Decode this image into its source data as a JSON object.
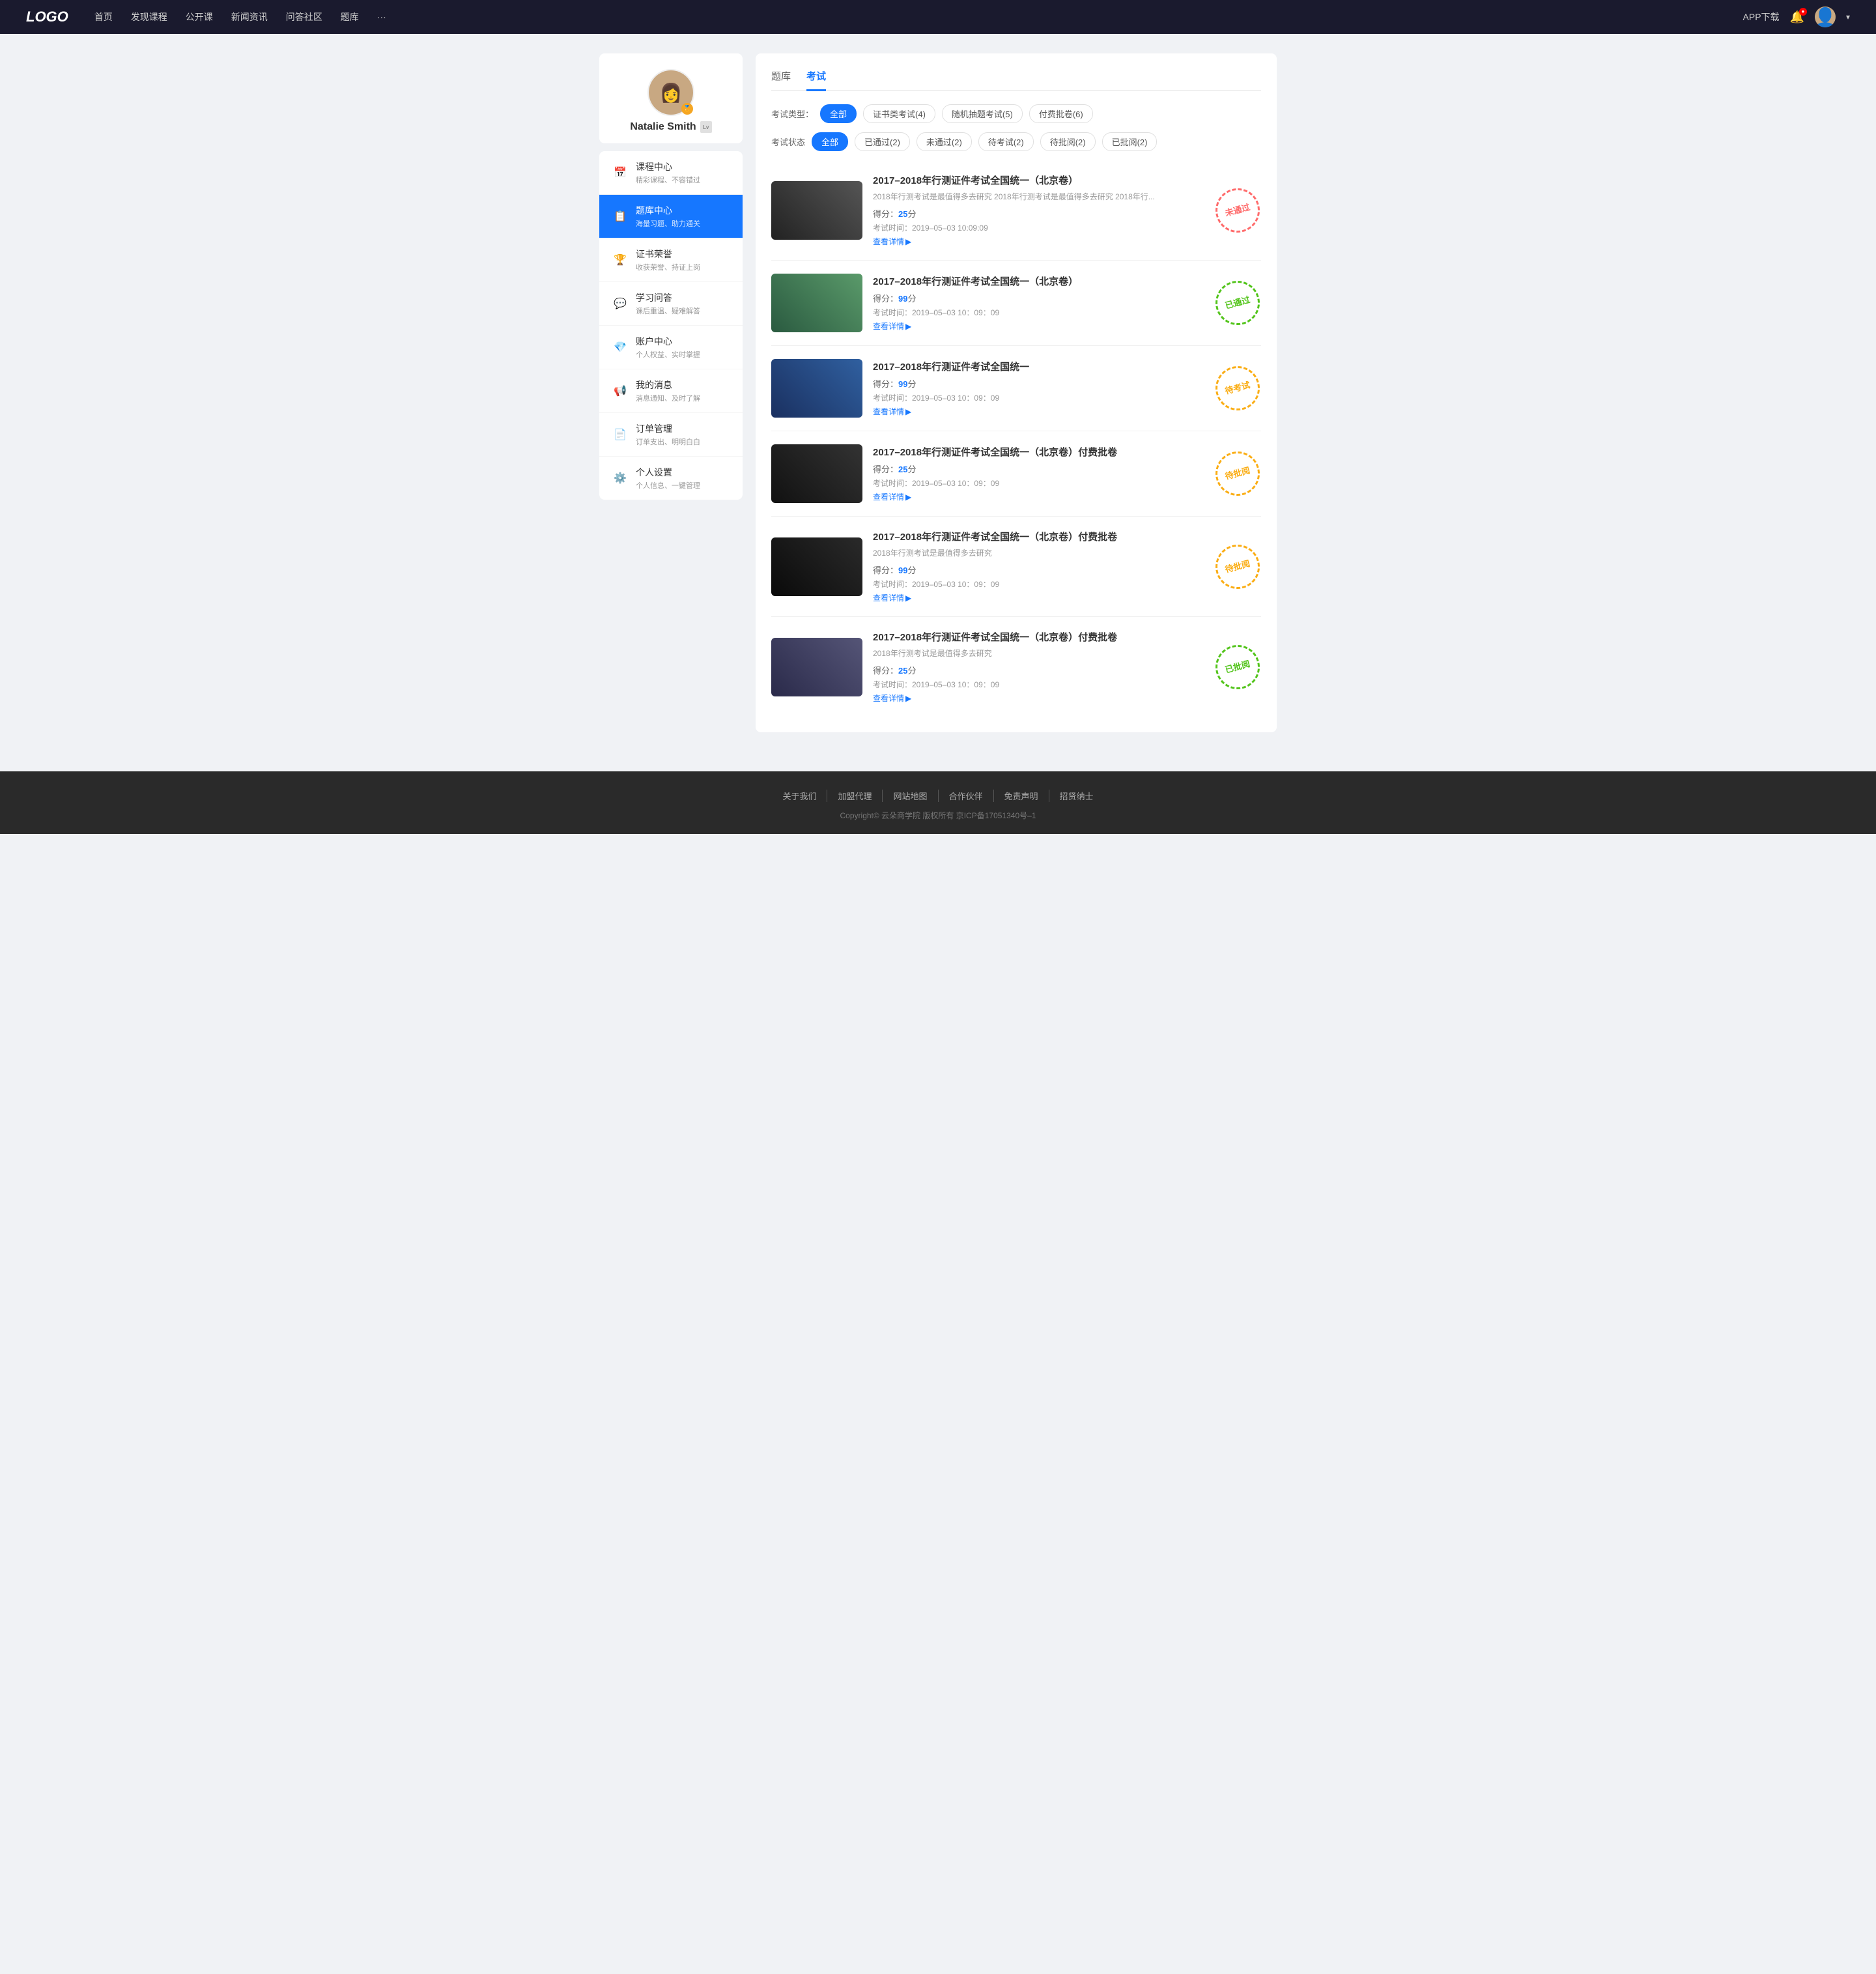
{
  "header": {
    "logo": "LOGO",
    "nav": [
      {
        "label": "首页"
      },
      {
        "label": "发现课程"
      },
      {
        "label": "公开课"
      },
      {
        "label": "新闻资讯"
      },
      {
        "label": "问答社区"
      },
      {
        "label": "题库"
      },
      {
        "label": "···"
      }
    ],
    "app_download": "APP下载",
    "chevron": "▾"
  },
  "sidebar": {
    "user": {
      "name": "Natalie Smith",
      "badge": "🏅"
    },
    "menu": [
      {
        "icon": "📅",
        "label": "课程中心",
        "sub": "精彩课程、不容错过",
        "active": false
      },
      {
        "icon": "📋",
        "label": "题库中心",
        "sub": "海量习题、助力通关",
        "active": true
      },
      {
        "icon": "🏆",
        "label": "证书荣誉",
        "sub": "收获荣誉、持证上岗",
        "active": false
      },
      {
        "icon": "💬",
        "label": "学习问答",
        "sub": "课后重温、疑难解答",
        "active": false
      },
      {
        "icon": "💎",
        "label": "账户中心",
        "sub": "个人权益、实时掌握",
        "active": false
      },
      {
        "icon": "📢",
        "label": "我的消息",
        "sub": "消息通知、及时了解",
        "active": false
      },
      {
        "icon": "📄",
        "label": "订单管理",
        "sub": "订单支出、明明白白",
        "active": false
      },
      {
        "icon": "⚙️",
        "label": "个人设置",
        "sub": "个人信息、一键管理",
        "active": false
      }
    ]
  },
  "content": {
    "tabs": [
      {
        "label": "题库",
        "active": false
      },
      {
        "label": "考试",
        "active": true
      }
    ],
    "type_filter": {
      "label": "考试类型：",
      "options": [
        {
          "label": "全部",
          "active": true
        },
        {
          "label": "证书类考试(4)",
          "active": false
        },
        {
          "label": "随机抽题考试(5)",
          "active": false
        },
        {
          "label": "付费批卷(6)",
          "active": false
        }
      ]
    },
    "status_filter": {
      "label": "考试状态",
      "options": [
        {
          "label": "全部",
          "active": true
        },
        {
          "label": "已通过(2)",
          "active": false
        },
        {
          "label": "未通过(2)",
          "active": false
        },
        {
          "label": "待考试(2)",
          "active": false
        },
        {
          "label": "待批阅(2)",
          "active": false
        },
        {
          "label": "已批阅(2)",
          "active": false
        }
      ]
    },
    "exams": [
      {
        "title": "2017–2018年行测证件考试全国统一（北京卷）",
        "desc": "2018年行测考试是最值得多去研究 2018年行测考试是最值得多去研究 2018年行...",
        "score_label": "得分：",
        "score": "25",
        "score_unit": "分",
        "time_label": "考试时间：",
        "time": "2019–05–03  10:09:09",
        "detail": "查看详情",
        "stamp_text": "未通过",
        "stamp_type": "fail",
        "thumb_class": "thumb-1"
      },
      {
        "title": "2017–2018年行测证件考试全国统一（北京卷）",
        "desc": "",
        "score_label": "得分：",
        "score": "99",
        "score_unit": "分",
        "time_label": "考试时间：",
        "time": "2019–05–03  10：09：09",
        "detail": "查看详情",
        "stamp_text": "已通过",
        "stamp_type": "pass",
        "thumb_class": "thumb-2"
      },
      {
        "title": "2017–2018年行测证件考试全国统一",
        "desc": "",
        "score_label": "得分：",
        "score": "99",
        "score_unit": "分",
        "time_label": "考试时间：",
        "time": "2019–05–03  10：09：09",
        "detail": "查看详情",
        "stamp_text": "待考试",
        "stamp_type": "pending",
        "thumb_class": "thumb-3"
      },
      {
        "title": "2017–2018年行测证件考试全国统一（北京卷）付费批卷",
        "desc": "",
        "score_label": "得分：",
        "score": "25",
        "score_unit": "分",
        "time_label": "考试时间：",
        "time": "2019–05–03  10：09：09",
        "detail": "查看详情",
        "stamp_text": "待批阅",
        "stamp_type": "review",
        "thumb_class": "thumb-4"
      },
      {
        "title": "2017–2018年行测证件考试全国统一（北京卷）付费批卷",
        "desc": "2018年行测考试是最值得多去研究",
        "score_label": "得分：",
        "score": "99",
        "score_unit": "分",
        "time_label": "考试时间：",
        "time": "2019–05–03  10：09：09",
        "detail": "查看详情",
        "stamp_text": "待批阅",
        "stamp_type": "review",
        "thumb_class": "thumb-5"
      },
      {
        "title": "2017–2018年行测证件考试全国统一（北京卷）付费批卷",
        "desc": "2018年行测考试是最值得多去研究",
        "score_label": "得分：",
        "score": "25",
        "score_unit": "分",
        "time_label": "考试时间：",
        "time": "2019–05–03  10：09：09",
        "detail": "查看详情",
        "stamp_text": "已批阅",
        "stamp_type": "reviewed",
        "thumb_class": "thumb-6"
      }
    ]
  },
  "footer": {
    "links": [
      {
        "label": "关于我们"
      },
      {
        "label": "加盟代理"
      },
      {
        "label": "网站地图"
      },
      {
        "label": "合作伙伴"
      },
      {
        "label": "免责声明"
      },
      {
        "label": "招贤纳士"
      }
    ],
    "copyright": "Copyright© 云朵商学院  版权所有    京ICP备17051340号–1"
  }
}
